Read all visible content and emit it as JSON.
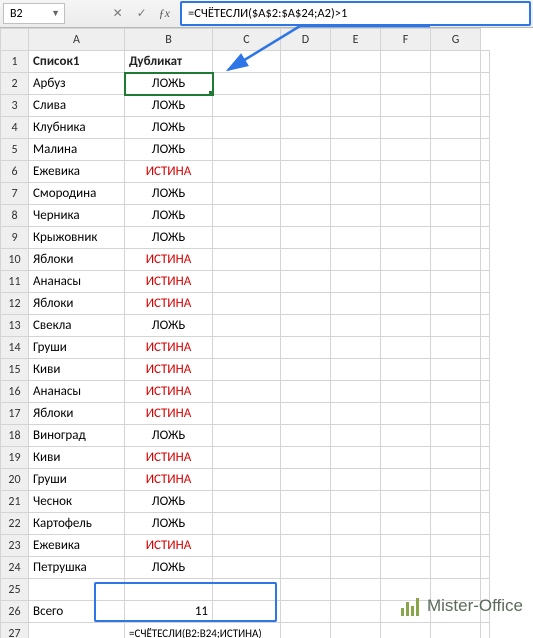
{
  "name_box": "B2",
  "formula_bar": "=СЧЁТЕСЛИ($A$2:$A$24;A2)>1",
  "columns": [
    "A",
    "B",
    "C",
    "D",
    "E",
    "F",
    "G"
  ],
  "headers": {
    "a1": "Список1",
    "b1": "Дубликат"
  },
  "rows": [
    {
      "n": 1,
      "a": "Список1",
      "b": "Дубликат",
      "hdr": true
    },
    {
      "n": 2,
      "a": "Арбуз",
      "b": "ЛОЖЬ",
      "red": false,
      "sel": true
    },
    {
      "n": 3,
      "a": "Слива",
      "b": "ЛОЖЬ",
      "red": false
    },
    {
      "n": 4,
      "a": "Клубника",
      "b": "ЛОЖЬ",
      "red": false
    },
    {
      "n": 5,
      "a": "Малина",
      "b": "ЛОЖЬ",
      "red": false
    },
    {
      "n": 6,
      "a": "Ежевика",
      "b": "ИСТИНА",
      "red": true
    },
    {
      "n": 7,
      "a": "Смородина",
      "b": "ЛОЖЬ",
      "red": false
    },
    {
      "n": 8,
      "a": "Черника",
      "b": "ЛОЖЬ",
      "red": false
    },
    {
      "n": 9,
      "a": "Крыжовник",
      "b": "ЛОЖЬ",
      "red": false
    },
    {
      "n": 10,
      "a": "Яблоки",
      "b": "ИСТИНА",
      "red": true
    },
    {
      "n": 11,
      "a": "Ананасы",
      "b": "ИСТИНА",
      "red": true
    },
    {
      "n": 12,
      "a": "Яблоки",
      "b": "ИСТИНА",
      "red": true
    },
    {
      "n": 13,
      "a": "Свекла",
      "b": "ЛОЖЬ",
      "red": false
    },
    {
      "n": 14,
      "a": "Груши",
      "b": "ИСТИНА",
      "red": true
    },
    {
      "n": 15,
      "a": "Киви",
      "b": "ИСТИНА",
      "red": true
    },
    {
      "n": 16,
      "a": "Ананасы",
      "b": "ИСТИНА",
      "red": true
    },
    {
      "n": 17,
      "a": "Яблоки",
      "b": "ИСТИНА",
      "red": true
    },
    {
      "n": 18,
      "a": "Виноград",
      "b": "ЛОЖЬ",
      "red": false
    },
    {
      "n": 19,
      "a": "Киви",
      "b": "ИСТИНА",
      "red": true
    },
    {
      "n": 20,
      "a": "Груши",
      "b": "ИСТИНА",
      "red": true
    },
    {
      "n": 21,
      "a": "Чеснок",
      "b": "ЛОЖЬ",
      "red": false
    },
    {
      "n": 22,
      "a": "Картофель",
      "b": "ЛОЖЬ",
      "red": false
    },
    {
      "n": 23,
      "a": "Ежевика",
      "b": "ИСТИНА",
      "red": true
    },
    {
      "n": 24,
      "a": "Петрушка",
      "b": "ЛОЖЬ",
      "red": false
    },
    {
      "n": 25,
      "a": "",
      "b": ""
    },
    {
      "n": 26,
      "a": "Всего",
      "b": "11",
      "sum": true
    },
    {
      "n": 27,
      "a": "",
      "b": "=СЧЁТЕСЛИ(B2:B24;ИСТИНА)",
      "wide": true
    }
  ],
  "watermark": "Mister-Office",
  "icons": {
    "cancel": "✕",
    "accept": "✓"
  }
}
